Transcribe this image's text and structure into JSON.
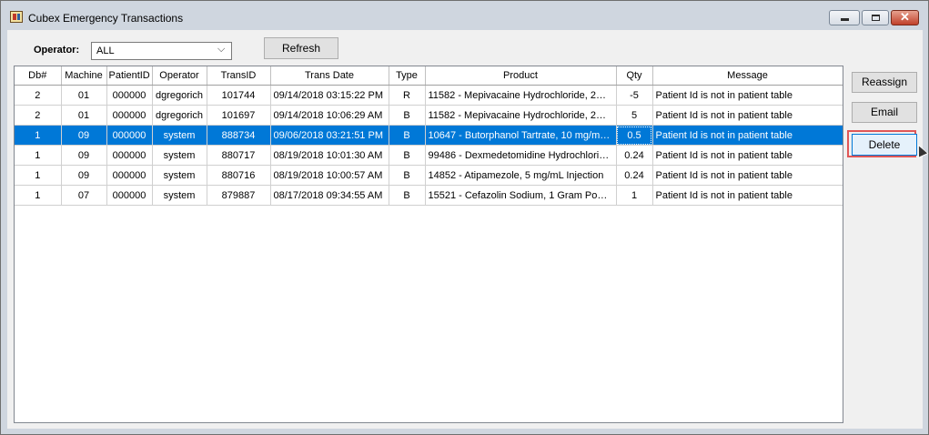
{
  "window": {
    "title": "Cubex Emergency Transactions",
    "close_glyph": "✕"
  },
  "toolbar": {
    "operator_label": "Operator:",
    "operator_value": "ALL",
    "dropdown_arrow": "⌵",
    "refresh_label": "Refresh"
  },
  "actions": {
    "reassign_label": "Reassign",
    "email_label": "Email",
    "delete_label": "Delete"
  },
  "table": {
    "headers": [
      "Db#",
      "Machine",
      "PatientID",
      "Operator",
      "TransID",
      "Trans Date",
      "Type",
      "Product",
      "Qty",
      "Message"
    ],
    "rows": [
      [
        "2",
        "01",
        "000000",
        "dgregorich",
        "101744",
        "09/14/2018 03:15:22 PM",
        "R",
        "11582 - Mepivacaine Hydrochloride, 2% ...",
        "-5",
        "Patient Id is not in patient table"
      ],
      [
        "2",
        "01",
        "000000",
        "dgregorich",
        "101697",
        "09/14/2018 10:06:29 AM",
        "B",
        "11582 - Mepivacaine Hydrochloride, 2% ...",
        "5",
        "Patient Id is not in patient table"
      ],
      [
        "1",
        "09",
        "000000",
        "system",
        "888734",
        "09/06/2018 03:21:51 PM",
        "B",
        "10647 - Butorphanol Tartrate, 10 mg/mL ...",
        "0.5",
        "Patient Id is not in patient table"
      ],
      [
        "1",
        "09",
        "000000",
        "system",
        "880717",
        "08/19/2018 10:01:30 AM",
        "B",
        "99486 - Dexmedetomidine Hydrochloride...",
        "0.24",
        "Patient Id is not in patient table"
      ],
      [
        "1",
        "09",
        "000000",
        "system",
        "880716",
        "08/19/2018 10:00:57 AM",
        "B",
        "14852 - Atipamezole, 5 mg/mL Injection",
        "0.24",
        "Patient Id is not in patient table"
      ],
      [
        "1",
        "07",
        "000000",
        "system",
        "879887",
        "08/17/2018 09:34:55 AM",
        "B",
        "15521 - Cefazolin Sodium, 1 Gram Powd...",
        "1",
        "Patient Id is not in patient table"
      ]
    ]
  },
  "icons": {
    "app": "cubex-app-icon",
    "minimize": "minimize-icon",
    "maximize": "maximize-icon",
    "close": "close-icon"
  },
  "colors": {
    "selection": "#0078d7",
    "highlight_border": "#e05656",
    "close_button": "#c0402a"
  }
}
